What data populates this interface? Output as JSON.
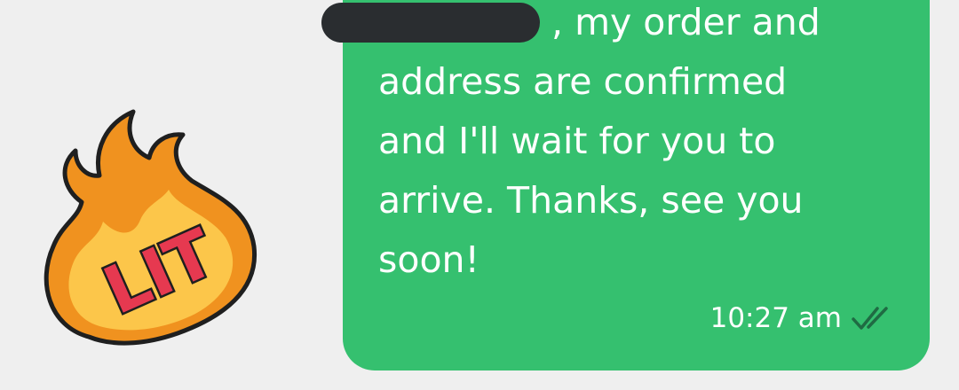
{
  "sticker": {
    "text": "LIT",
    "icon": "fire-lit-sticker-icon",
    "colors": {
      "flame_outer": "#f0921f",
      "flame_inner": "#fcc64a",
      "letters": "#e63950",
      "outline": "#1f1f1f"
    }
  },
  "message": {
    "lines": [
      ", my order and",
      "address are confirmed",
      "and I'll wait for you to",
      "arrive. Thanks, see you",
      "soon!"
    ],
    "time": "10:27 am",
    "status_icon": "double-check-read-icon",
    "bubble_color": "#35c06f",
    "redaction_color": "#2a2d30"
  }
}
